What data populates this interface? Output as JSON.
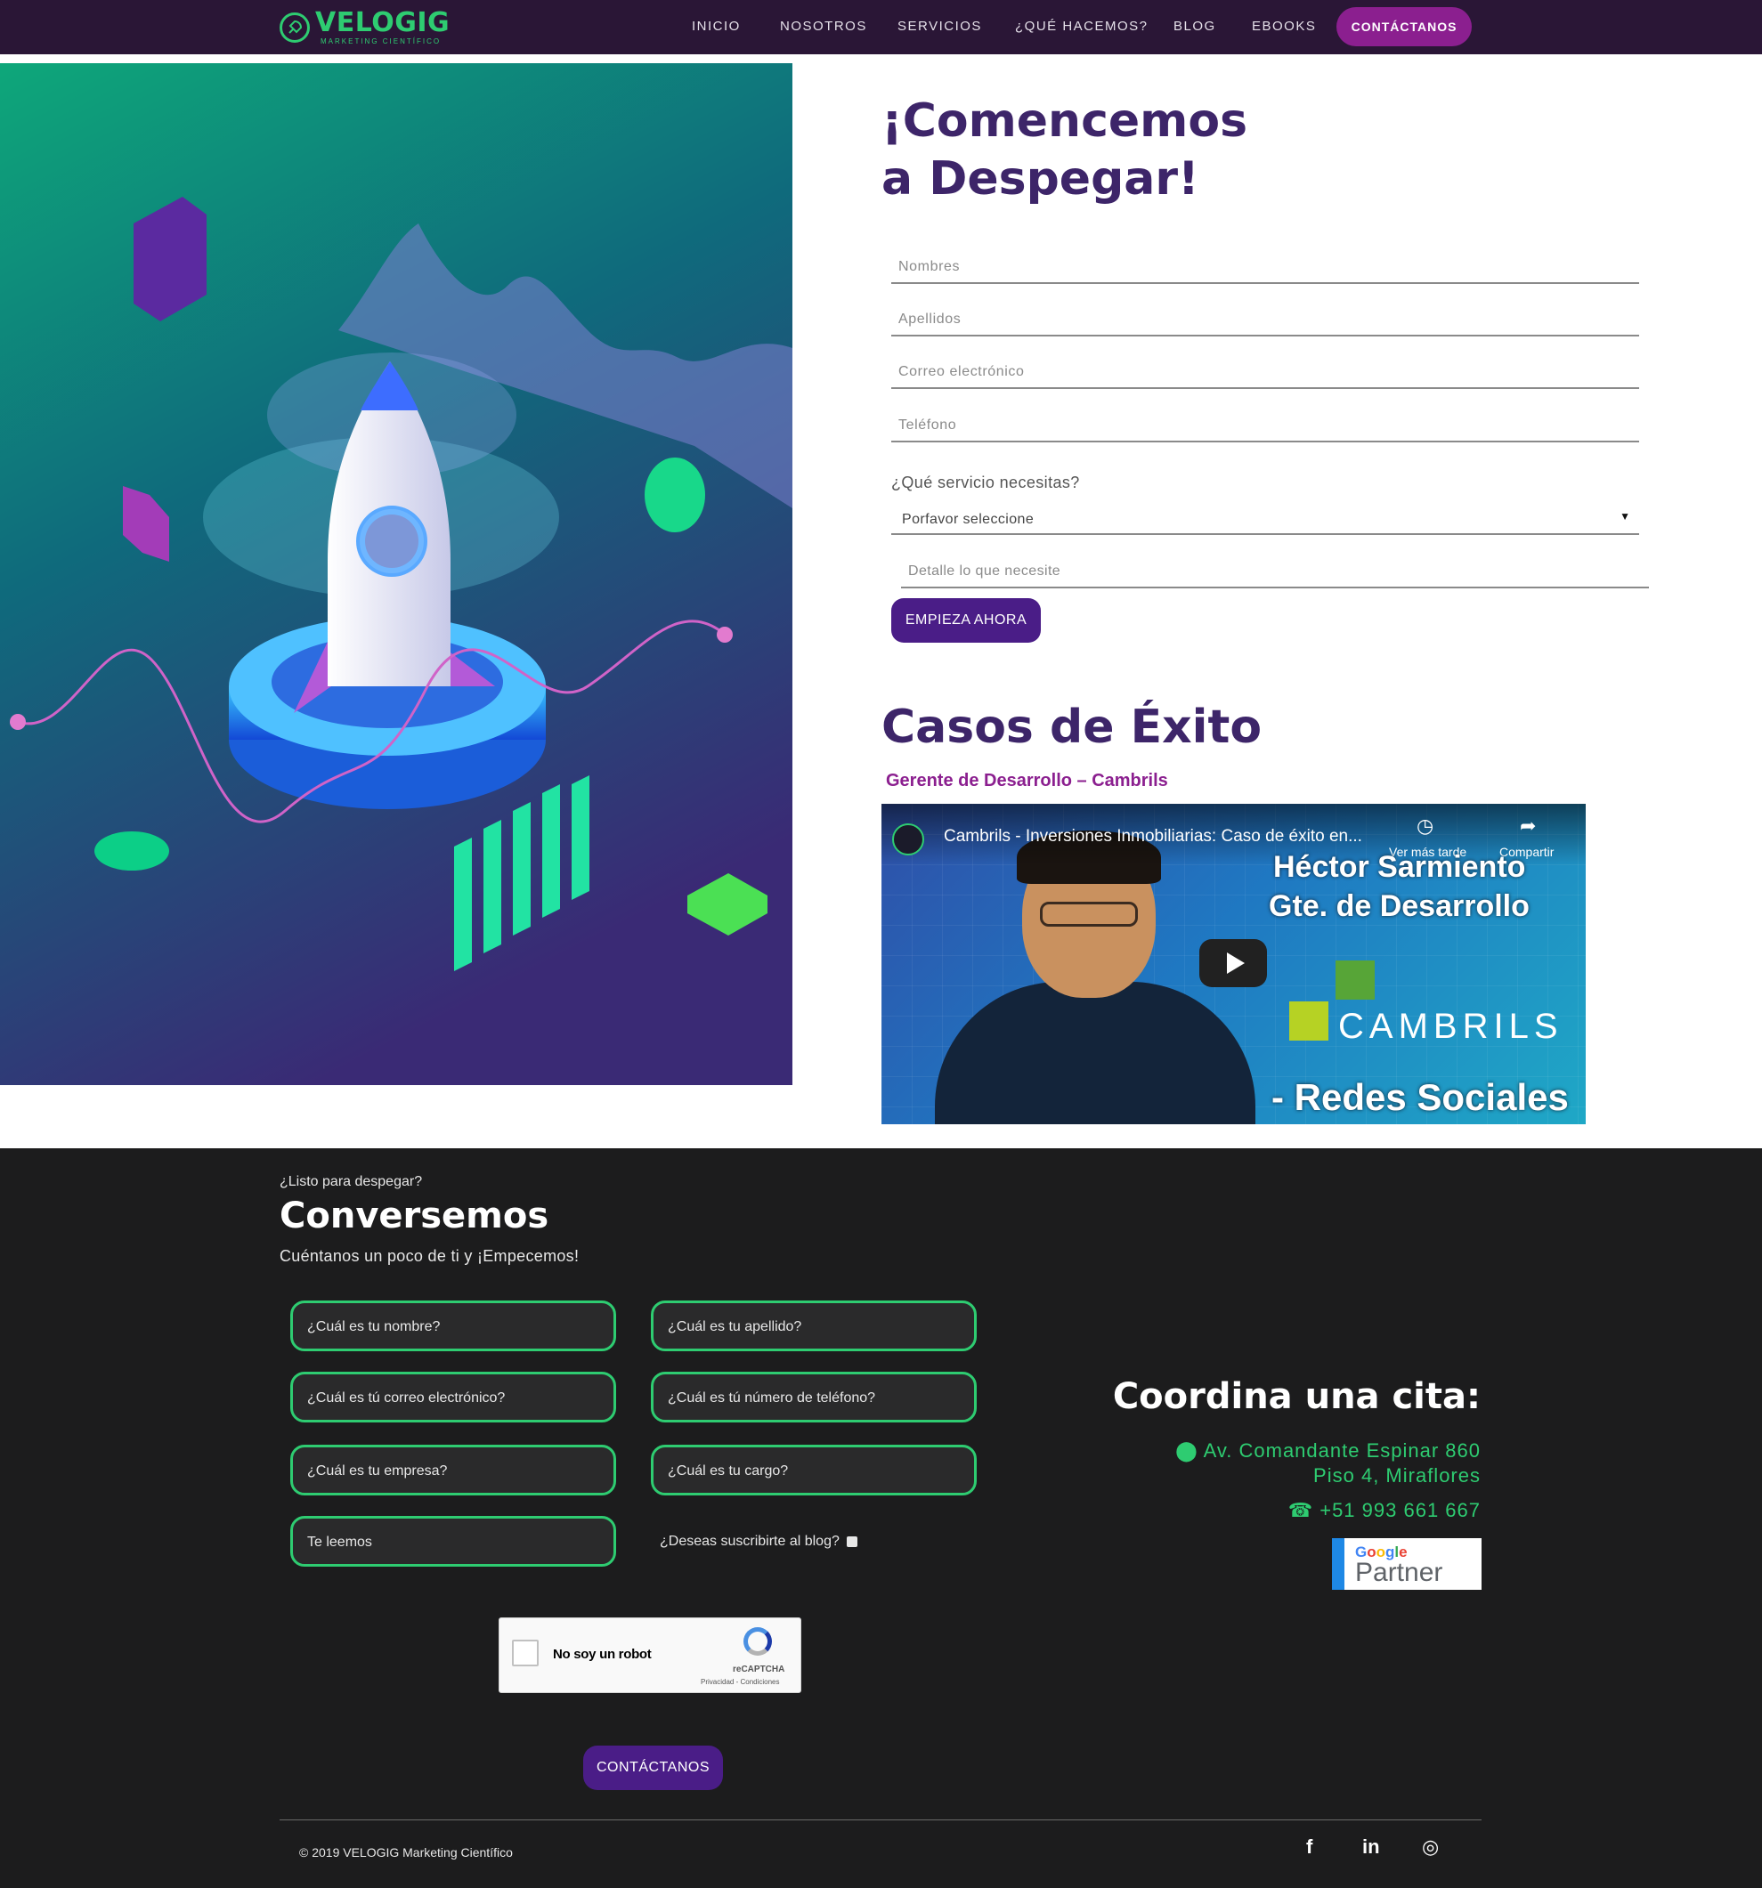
{
  "nav": {
    "logo_name": "VELOGIG",
    "logo_tagline": "Marketing Científico",
    "items": [
      "INICIO",
      "NOSOTROS",
      "SERVICIOS",
      "¿QUÉ HACEMOS?",
      "BLOG",
      "EBOOKS"
    ],
    "cta": "CONTÁCTANOS"
  },
  "form": {
    "title_line1": "¡Comencemos",
    "title_line2": "a Despegar!",
    "fields": [
      "Nombres",
      "Apellidos",
      "Correo electrónico",
      "Teléfono"
    ],
    "service_label": "¿Qué servicio necesitas?",
    "service_selected": "Porfavor seleccione",
    "detail_placeholder": "Detalle lo que necesite",
    "submit": "EMPIEZA AHORA"
  },
  "cases": {
    "title": "Casos de Éxito",
    "subtitle": "Gerente de Desarrollo – Cambrils",
    "video": {
      "title": "Cambrils - Inversiones Inmobiliarias: Caso de éxito en...",
      "watch_later": "Ver más tarde",
      "share": "Compartir",
      "name_line": "Héctor Sarmiento",
      "role_line": "Gte. de Desarrollo",
      "brand": "CAMBRILS",
      "banner": "- Redes Sociales"
    }
  },
  "footer": {
    "kicker": "¿Listo para despegar?",
    "title": "Conversemos",
    "subtitle": "Cuéntanos un poco de ti y ¡Empecemos!",
    "inputs": [
      "¿Cuál es tu nombre?",
      "¿Cuál es tu apellido?",
      "¿Cuál es tú correo electrónico?",
      "¿Cuál es tú número de teléfono?",
      "¿Cuál es tu empresa?",
      "¿Cuál es tu cargo?",
      "Te leemos"
    ],
    "subscribe": "¿Deseas suscribirte al blog?",
    "recaptcha": {
      "label": "No soy un robot",
      "brand": "reCAPTCHA",
      "links": "Privacidad - Condiciones"
    },
    "submit": "CONTÁCTANOS",
    "cita": {
      "title": "Coordina una cita:",
      "address_line1": "Av. Comandante Espinar 860",
      "address_line2": "Piso 4, Miraflores",
      "phone": "+51 993 661 667",
      "badge_google": "Google",
      "badge_partner": "Partner"
    },
    "copyright": "© 2019 VELOGIG Marketing Científico",
    "social": [
      "facebook-icon",
      "linkedin-icon",
      "instagram-icon"
    ]
  },
  "colors": {
    "nav_bg": "#2a1636",
    "accent_purple": "#4a1d87",
    "accent_magenta": "#8b1f8f",
    "accent_green": "#2ecc71",
    "title_purple": "#3d2569",
    "footer_bg": "#1c1c1d"
  }
}
